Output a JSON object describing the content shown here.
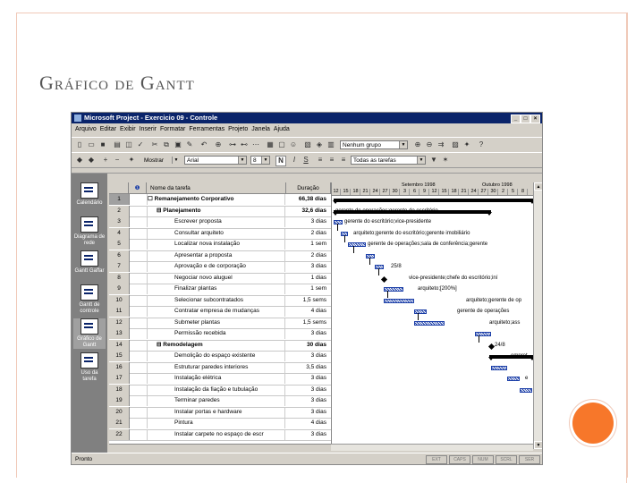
{
  "slide": {
    "title": "Gráfico de Gantt",
    "orb_color": "#f7772a",
    "border_color": "#f0c9b8"
  },
  "app": {
    "window_title": "Microsoft Project - Exercicio 09 - Controle",
    "menu": [
      "Arquivo",
      "Editar",
      "Exibir",
      "Inserir",
      "Formatar",
      "Ferramentas",
      "Projeto",
      "Janela",
      "Ajuda"
    ],
    "toolbar": {
      "group_combo": "Nenhum grupo",
      "view_combo": "Mostrar",
      "font_combo": "Arial",
      "size_combo": "8",
      "filter_combo": "Todas as tarefas",
      "bold_label": "N",
      "italic_label": "I",
      "underline_label": "S"
    },
    "view_bar": [
      {
        "label": "Calendário",
        "icon": "calendar-icon"
      },
      {
        "label": "Diagrama de rede",
        "icon": "network-icon"
      },
      {
        "label": "Gantt Gaffar",
        "icon": "gantt-icon"
      },
      {
        "label": "Gantt de controle",
        "icon": "tracking-gantt-icon"
      },
      {
        "label": "Gráfico de Gantt",
        "icon": "gantt-chart-icon"
      },
      {
        "label": "Uso da tarefa",
        "icon": "task-usage-icon"
      }
    ],
    "table": {
      "headers": {
        "id": "",
        "info": "❶",
        "name": "Nome da tarefa",
        "duration": "Duração"
      },
      "rows": [
        {
          "id": "1",
          "name": "☐ Remanejamento Corporativo",
          "duration": "66,38 dias",
          "bold": true
        },
        {
          "id": "2",
          "name": "⊟ Planejamento",
          "duration": "32,6 dias",
          "bold": true
        },
        {
          "id": "3",
          "name": "Escrever proposta",
          "duration": "3 dias"
        },
        {
          "id": "4",
          "name": "Consultar arquiteto",
          "duration": "2 dias"
        },
        {
          "id": "5",
          "name": "Localizar nova instalação",
          "duration": "1 sem"
        },
        {
          "id": "6",
          "name": "Apresentar a proposta",
          "duration": "2 dias"
        },
        {
          "id": "7",
          "name": "Aprovação e de corporação",
          "duration": "3 dias"
        },
        {
          "id": "8",
          "name": "Negociar novo aluguel",
          "duration": "1 dias"
        },
        {
          "id": "9",
          "name": "Finalizar plantas",
          "duration": "1 sem"
        },
        {
          "id": "10",
          "name": "Selecionar subcontratados",
          "duration": "1,5 sems"
        },
        {
          "id": "11",
          "name": "Contratar empresa de mudanças",
          "duration": "4 dias"
        },
        {
          "id": "12",
          "name": "Submeter plantas",
          "duration": "1,5 sems"
        },
        {
          "id": "13",
          "name": "Permissão recebida",
          "duration": "3 dias"
        },
        {
          "id": "14",
          "name": "⊟ Remodelagem",
          "duration": "30 dias",
          "bold": true
        },
        {
          "id": "15",
          "name": "Demolição do espaço existente",
          "duration": "3 dias"
        },
        {
          "id": "16",
          "name": "Estruturar paredes interiores",
          "duration": "3,5 dias"
        },
        {
          "id": "17",
          "name": "Instalação elétrica",
          "duration": "3 dias"
        },
        {
          "id": "18",
          "name": "Instalação da fiação e tubulação",
          "duration": "3 dias"
        },
        {
          "id": "19",
          "name": "Terminar paredes",
          "duration": "3 dias"
        },
        {
          "id": "20",
          "name": "Instalar portas e hardware",
          "duration": "3 dias"
        },
        {
          "id": "21",
          "name": "Pintura",
          "duration": "4 dias"
        },
        {
          "id": "22",
          "name": "Instalar carpete no espaço de escr",
          "duration": "3 dias"
        }
      ]
    },
    "timescale": {
      "weeks": [
        "Setembro 1998",
        "Outubro 1998"
      ],
      "days": [
        "12",
        "15",
        "18",
        "21",
        "24",
        "27",
        "30",
        "3",
        "6",
        "9",
        "12",
        "15",
        "18",
        "21",
        "24",
        "27",
        "30",
        "2",
        "5",
        "8"
      ]
    },
    "gantt_labels": [
      "gerente de operações;gerente do escritório",
      "gerente do escritório;vice-presidente",
      "arquiteto;gerente do escritório;gerente imobiliário",
      "gerente de operações;sala de conferência;gerente",
      "25/8",
      "vice-presidente;chefe do escritório;iní",
      "arquiteto;[200%]",
      "arquiteto;gerente de op",
      "gerente de operações",
      "arquiteto;ass",
      "24/8",
      "empret",
      "e"
    ],
    "status": {
      "text": "Pronto",
      "indicators": [
        "EXT",
        "CAPS",
        "NUM",
        "SCRL",
        "SER"
      ]
    }
  }
}
